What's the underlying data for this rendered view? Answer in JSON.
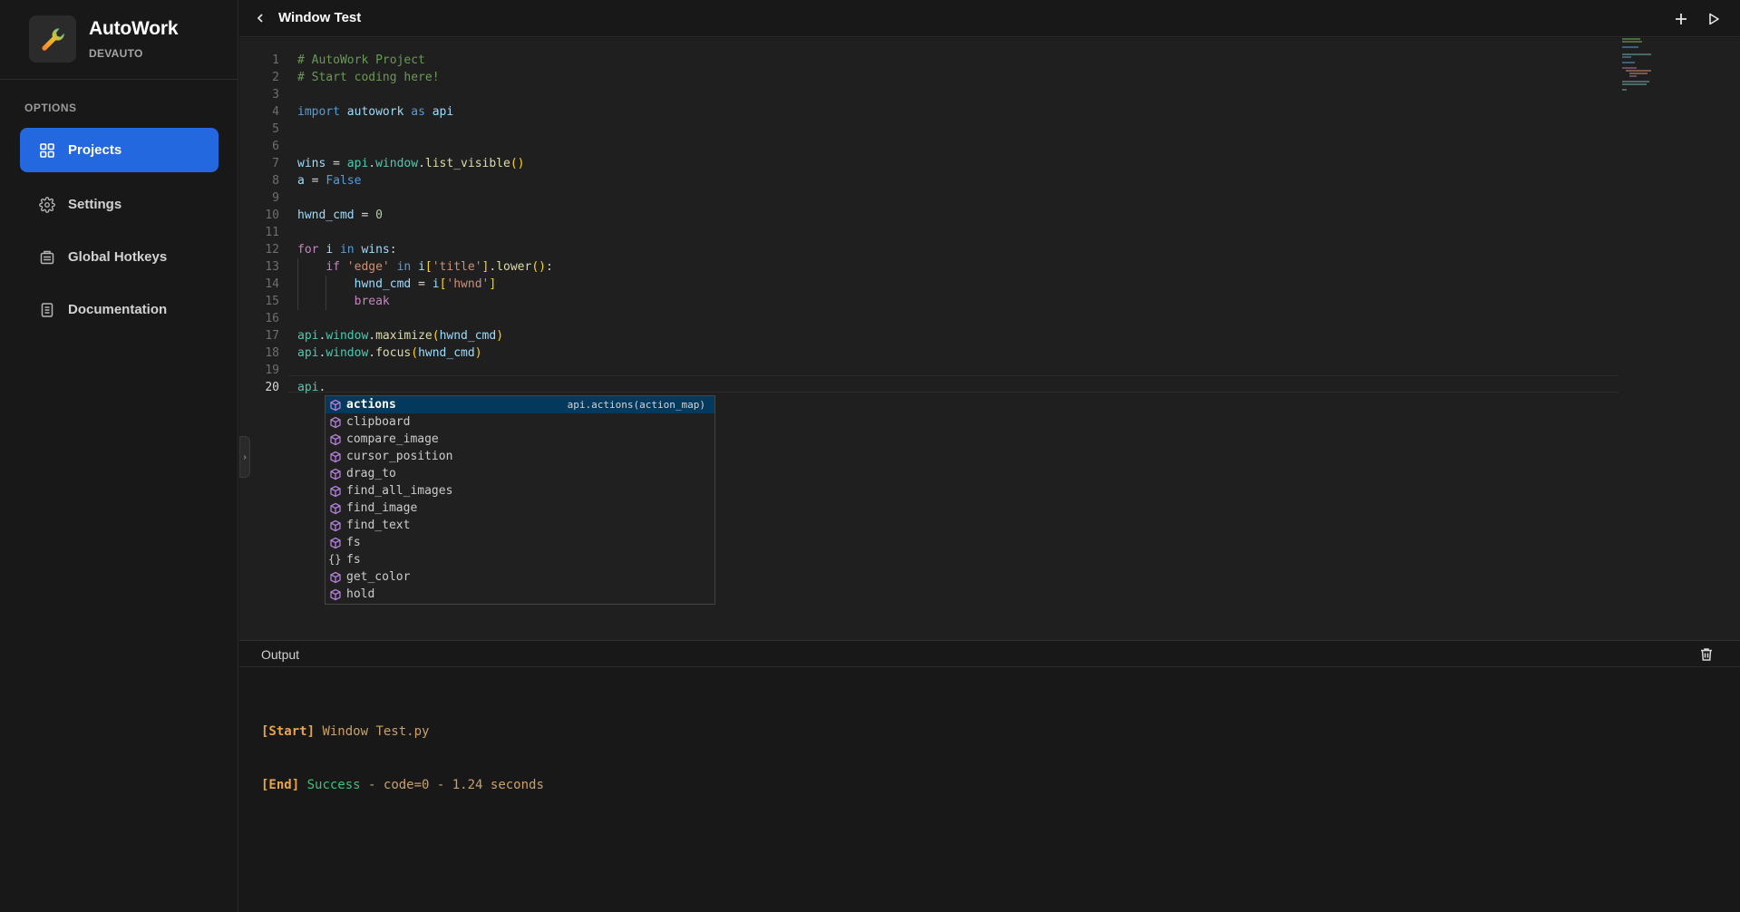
{
  "app": {
    "name": "AutoWork",
    "subtitle": "DEVAUTO"
  },
  "sidebar": {
    "section_label": "OPTIONS",
    "items": [
      {
        "label": "Projects",
        "icon": "grid-icon",
        "active": true
      },
      {
        "label": "Settings",
        "icon": "gear-icon",
        "active": false
      },
      {
        "label": "Global Hotkeys",
        "icon": "keyboard-icon",
        "active": false
      },
      {
        "label": "Documentation",
        "icon": "document-icon",
        "active": false
      }
    ]
  },
  "header": {
    "title": "Window Test"
  },
  "editor": {
    "line_numbers": [
      "1",
      "2",
      "3",
      "4",
      "5",
      "6",
      "7",
      "8",
      "9",
      "10",
      "11",
      "12",
      "13",
      "14",
      "15",
      "16",
      "17",
      "18",
      "19",
      "20"
    ],
    "current_line": "20",
    "lines": {
      "l1": "# AutoWork Project",
      "l2": "# Start coding here!",
      "l4_import": "import",
      "l4_module": "autowork",
      "l4_as": "as",
      "l4_alias": "api",
      "l7_var": "wins",
      "l7_eq": " = ",
      "l7_api": "api",
      "l7_dot": ".",
      "l7_window": "window",
      "l7_dot2": ".",
      "l7_fn": "list_visible",
      "l7_paren": "()",
      "l8_var": "a",
      "l8_eq": " = ",
      "l8_val": "False",
      "l10_var": "hwnd_cmd",
      "l10_eq": " = ",
      "l10_val": "0",
      "l12_for": "for",
      "l12_i": "i",
      "l12_in": "in",
      "l12_wins": "wins",
      "l12_colon": ":",
      "l13_if": "if",
      "l13_str": "'edge'",
      "l13_in": "in",
      "l13_i": "i",
      "l13_br_open": "[",
      "l13_key": "'title'",
      "l13_br_close": "]",
      "l13_dot": ".",
      "l13_fn": "lower",
      "l13_paren": "()",
      "l13_colon": ":",
      "l14_var": "hwnd_cmd",
      "l14_eq": " = ",
      "l14_i": "i",
      "l14_br_open": "[",
      "l14_key": "'hwnd'",
      "l14_br_close": "]",
      "l15_break": "break",
      "l17_api": "api",
      "l17_dot": ".",
      "l17_window": "window",
      "l17_dot2": ".",
      "l17_fn": "maximize",
      "l17_open": "(",
      "l17_arg": "hwnd_cmd",
      "l17_close": ")",
      "l18_api": "api",
      "l18_dot": ".",
      "l18_window": "window",
      "l18_dot2": ".",
      "l18_fn": "focus",
      "l18_open": "(",
      "l18_arg": "hwnd_cmd",
      "l18_close": ")",
      "l20_api": "api",
      "l20_dot": "."
    }
  },
  "autocomplete": {
    "selected_detail": "api.actions(action_map)",
    "items": [
      {
        "label": "actions",
        "kind": "module"
      },
      {
        "label": "clipboard",
        "kind": "module"
      },
      {
        "label": "compare_image",
        "kind": "module"
      },
      {
        "label": "cursor_position",
        "kind": "module"
      },
      {
        "label": "drag_to",
        "kind": "module"
      },
      {
        "label": "find_all_images",
        "kind": "module"
      },
      {
        "label": "find_image",
        "kind": "module"
      },
      {
        "label": "find_text",
        "kind": "module"
      },
      {
        "label": "fs",
        "kind": "module"
      },
      {
        "label": "fs",
        "kind": "variable"
      },
      {
        "label": "get_color",
        "kind": "module"
      },
      {
        "label": "hold",
        "kind": "module"
      }
    ]
  },
  "output": {
    "title": "Output",
    "start_tag": "[Start]",
    "start_text": "Window Test.py",
    "end_tag": "[End]",
    "end_status": "Success",
    "end_text": " - code=0 - 1.24 seconds"
  },
  "colors": {
    "accent": "#2468e0",
    "success": "#3cc27a",
    "tag": "#e8a34a"
  }
}
